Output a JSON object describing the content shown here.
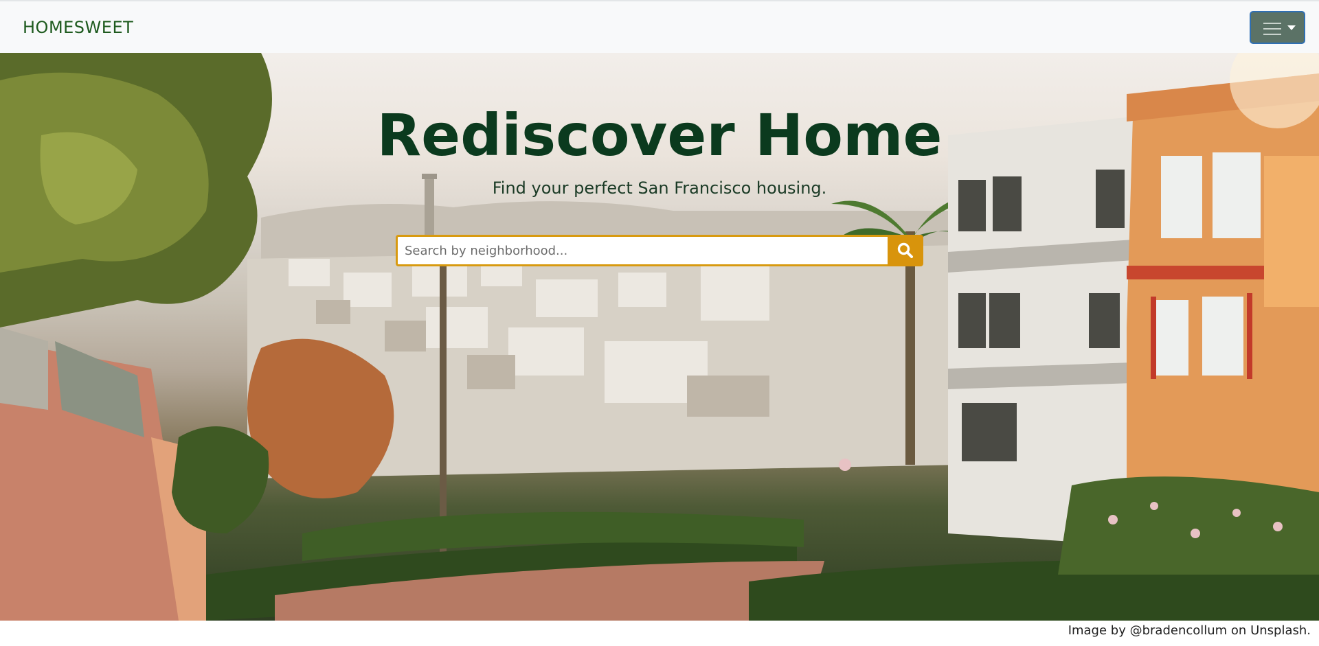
{
  "navbar": {
    "brand": "HOMESWEET",
    "toggler_icon": "hamburger-menu-icon"
  },
  "hero": {
    "title": "Rediscover Home",
    "subtitle": "Find your perfect San Francisco housing.",
    "search": {
      "placeholder": "Search by neighborhood...",
      "value": "",
      "button_icon": "search-icon"
    }
  },
  "footer": {
    "credit": "Image by @bradencollum on Unsplash."
  },
  "colors": {
    "navbar_bg": "#f8f9fa",
    "brand": "#1e5a1e",
    "title": "#0b3a1e",
    "accent": "#d8940c",
    "toggler_bg": "#5b7266"
  }
}
